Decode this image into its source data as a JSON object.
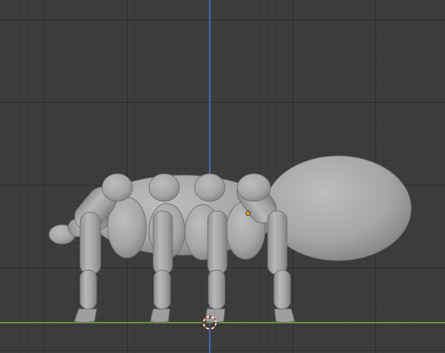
{
  "viewport": {
    "background_color": "#3d3d3d",
    "grid_color": "#2f2f2f",
    "z_axis_color": "#4a6fb0",
    "y_axis_color": "#6e9a3a",
    "object_color": "#a7a7a7",
    "origin_color": "#f5a623",
    "cursor_colors": [
      "#e04040",
      "#ffffff"
    ],
    "object": "spider-model"
  }
}
